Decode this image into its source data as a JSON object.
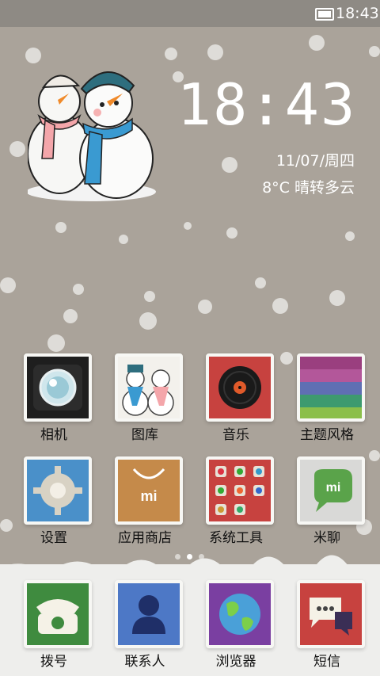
{
  "status_bar": {
    "time": "18:43",
    "battery_icon": "battery-icon"
  },
  "clock_widget": {
    "time": "18:43",
    "date": "11/07/周四",
    "weather": "8°C 晴转多云"
  },
  "home_apps": [
    {
      "label": "相机",
      "icon": "camera-icon"
    },
    {
      "label": "图库",
      "icon": "gallery-icon"
    },
    {
      "label": "音乐",
      "icon": "music-icon"
    },
    {
      "label": "主题风格",
      "icon": "theme-icon"
    },
    {
      "label": "设置",
      "icon": "settings-icon"
    },
    {
      "label": "应用商店",
      "icon": "app-store-icon"
    },
    {
      "label": "系统工具",
      "icon": "system-tools-icon"
    },
    {
      "label": "米聊",
      "icon": "miliao-icon"
    }
  ],
  "dock_apps": [
    {
      "label": "拨号",
      "icon": "phone-icon"
    },
    {
      "label": "联系人",
      "icon": "contacts-icon"
    },
    {
      "label": "浏览器",
      "icon": "browser-icon"
    },
    {
      "label": "短信",
      "icon": "messages-icon"
    }
  ],
  "page_indicator": {
    "pages": 3,
    "current": 2
  },
  "colors": {
    "wallpaper": "#aaa39a",
    "dock": "#eeeeec",
    "text": "#111111"
  }
}
